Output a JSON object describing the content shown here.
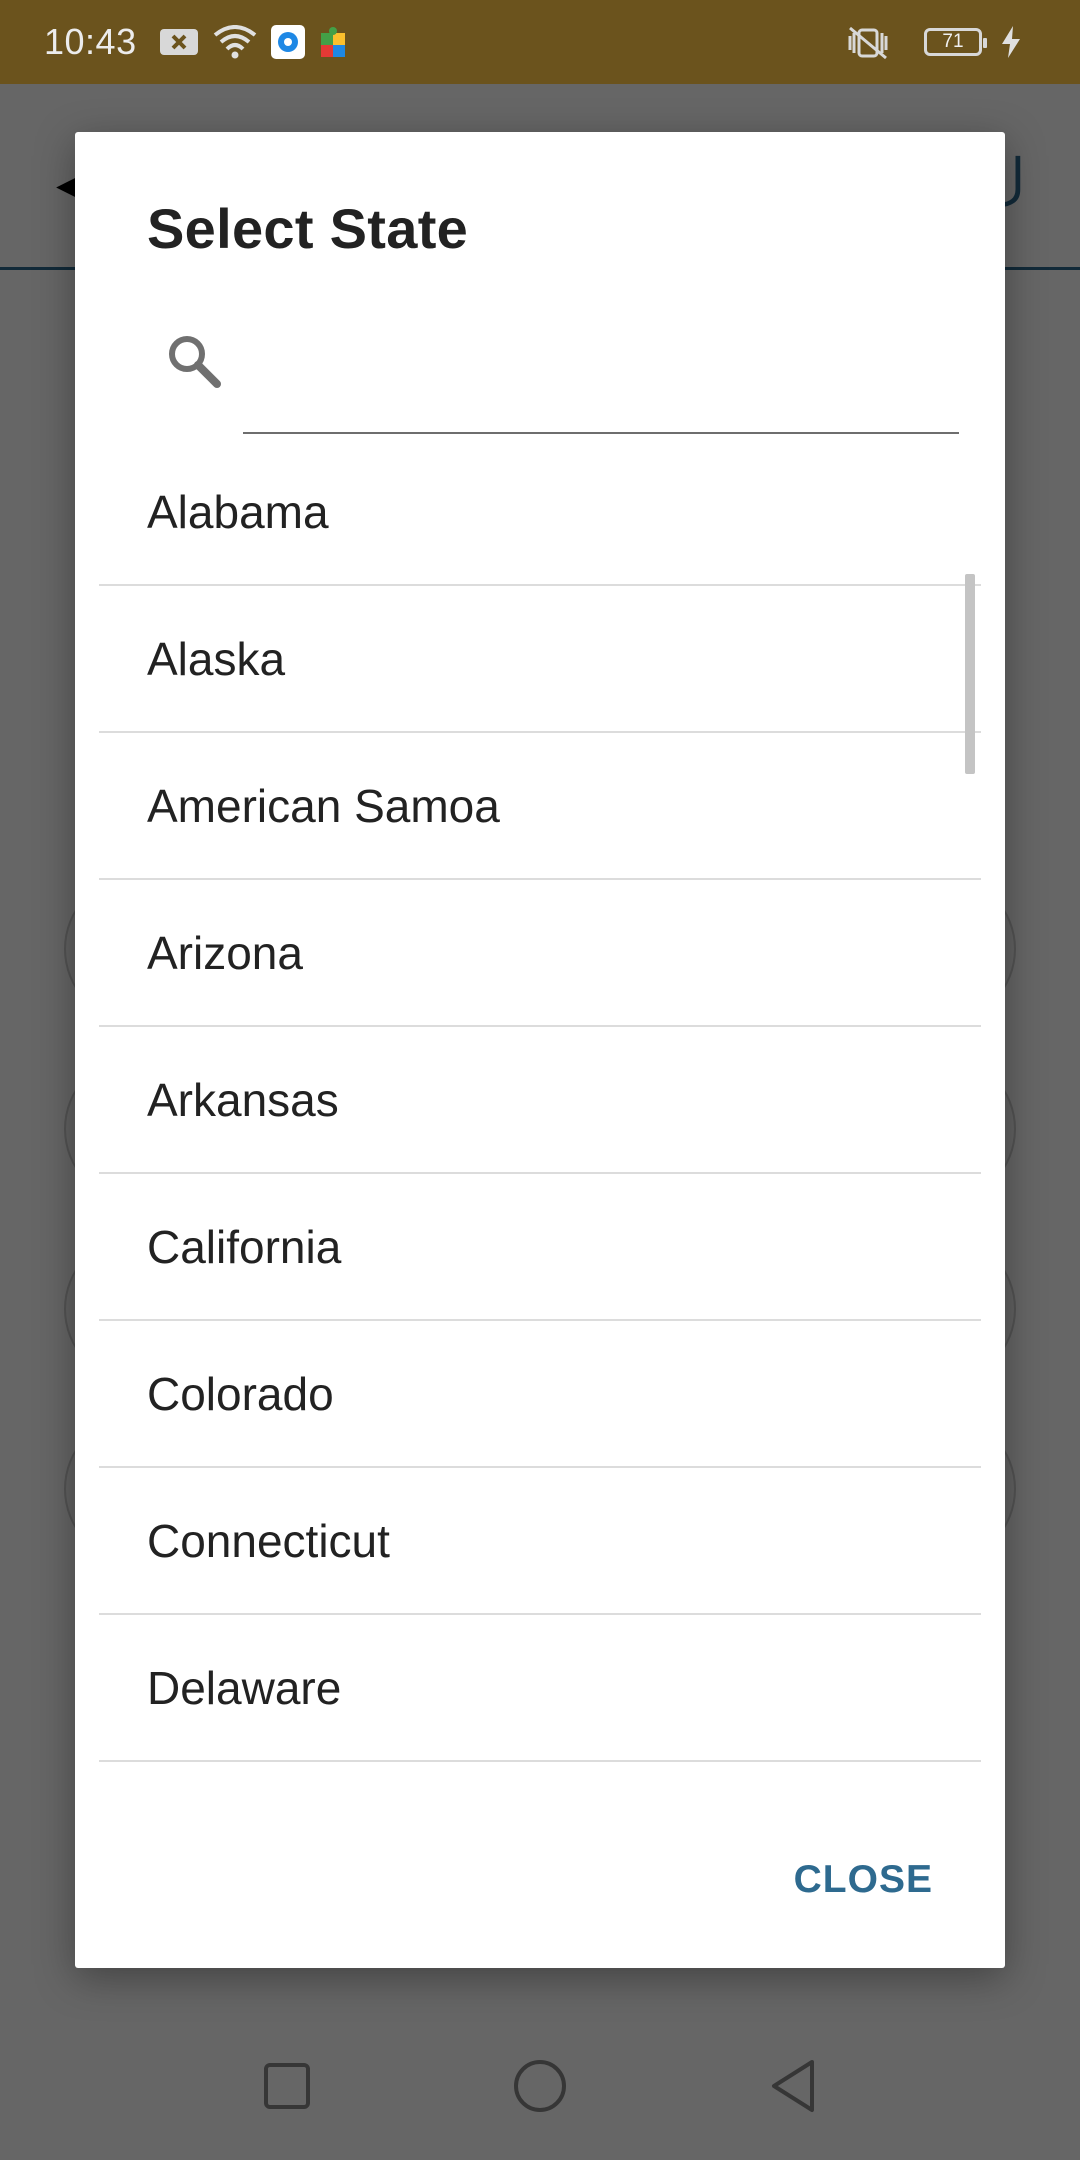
{
  "status_bar": {
    "time": "10:43",
    "battery_level": "71",
    "icons": [
      "notification-x-icon",
      "wifi-icon",
      "app-notification-icon",
      "puzzle-icon",
      "vibrate-off-icon",
      "battery-icon",
      "charging-icon"
    ]
  },
  "dialog": {
    "title": "Select State",
    "search_placeholder": "",
    "search_value": "",
    "states": [
      "Alabama",
      "Alaska",
      "American Samoa",
      "Arizona",
      "Arkansas",
      "California",
      "Colorado",
      "Connecticut",
      "Delaware"
    ],
    "close_label": "CLOSE"
  },
  "colors": {
    "status_bar_bg": "#6b531d",
    "accent": "#2e6a8f"
  }
}
